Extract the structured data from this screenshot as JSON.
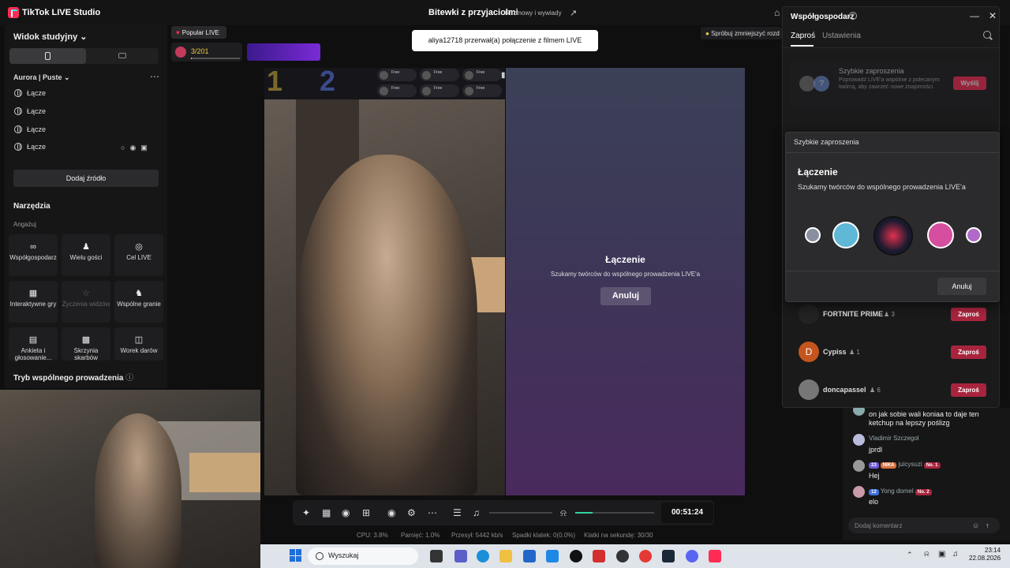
{
  "titlebar": {
    "app_title": "TikTok LIVE Studio",
    "stream_title": "Bitewki z przyjaciolmi",
    "stream_category": "Rozmowy i wywiady"
  },
  "sidebar": {
    "scene_view": "Widok studyjny",
    "scene_name": "Aurora | Puste",
    "sources": [
      "Łącze",
      "Łącze",
      "Łącze",
      "Łącze"
    ],
    "add_source": "Dodaj źródło",
    "tools_title": "Narzędzia",
    "engagement_label": "Angażuj",
    "tools": [
      {
        "label": "Współgospodarz",
        "icon": "link-icon"
      },
      {
        "label": "Wielu gości",
        "icon": "users-icon"
      },
      {
        "label": "Cel LIVE",
        "icon": "target-icon"
      },
      {
        "label": "Interaktywne gry",
        "icon": "gamepad-icon"
      },
      {
        "label": "Życzenia widzów",
        "icon": "star-icon"
      },
      {
        "label": "Wspólne granie",
        "icon": "joystick-icon"
      },
      {
        "label": "Ankieta i głosowanie...",
        "icon": "poll-icon"
      },
      {
        "label": "Skrzynia skarbów",
        "icon": "chest-icon"
      },
      {
        "label": "Worek darów",
        "icon": "gift-bag-icon"
      }
    ],
    "cohost_mode": "Tryb wspólnego prowadzenia"
  },
  "top": {
    "popular_live": "Popular LIVE",
    "goal_count": "3/201",
    "goal_progress": 0.015,
    "try_reduce": "Spróbuj zmniejszyć rozd"
  },
  "toast": "aliya12718 przerwał(a) połączenie z filmem LIVE",
  "scoreboard": {
    "left_number": "1",
    "right_number": "2",
    "slots": [
      "Free",
      "Free",
      "Free",
      "Free",
      "Free",
      "Free"
    ]
  },
  "connecting": {
    "title": "Łączenie",
    "subtitle": "Szukamy twórców do wspólnego prowadzenia LIVE'a",
    "cancel": "Anuluj"
  },
  "controls": {
    "timer": "00:51:24",
    "mic_level": 0.22
  },
  "stats": {
    "cpu": "CPU: 3.8%",
    "memory": "Pamięć: 1.0%",
    "sent": "Przesył: 5442 kb/s",
    "dropped": "Spadki klatek: 0(0.0%)",
    "fps": "Klatki na sekundę: 30/30"
  },
  "cohost_panel": {
    "title": "Współgospodarz",
    "tabs": [
      "Zaproś",
      "Ustawienia"
    ],
    "quick_invite_title": "Szybkie zaproszenia",
    "quick_invite_desc": "Poprowadź LIVE'a wspólnie z polecanym twórcą, aby zawrzeć nowe znajomości.",
    "send": "Wyślij",
    "popup": {
      "header": "Szybkie zaproszenia",
      "title": "Łączenie",
      "subtitle": "Szukamy twórców do wspólnego prowadzenia LIVE'a",
      "cancel": "Anuluj"
    },
    "creators": [
      {
        "name": "FORTNITE PRIME",
        "count": "3",
        "action": "Zaproś"
      },
      {
        "name": "Cypiss",
        "count": "1",
        "action": "Zaproś",
        "initial": "D"
      },
      {
        "name": "doncapassel",
        "count": "6",
        "action": "Zaproś"
      }
    ]
  },
  "chat": {
    "messages": [
      {
        "user": "",
        "text": "on jak sobie wali koniaa to daje ten ketchup na lepszy poślizg"
      },
      {
        "user": "Vladimir Szczegol",
        "text": "jprdl"
      },
      {
        "user": "juicysuzi",
        "badges": [
          "23",
          "NIKA",
          "No. 1"
        ],
        "text": "Hej"
      },
      {
        "user": "Yong domel",
        "badges": [
          "12",
          "No. 2"
        ],
        "text": "elo"
      }
    ],
    "placeholder": "Dodaj komentarz"
  },
  "taskbar": {
    "search": "Wyszukaj",
    "time": "23:14",
    "date": "22.08.2026"
  },
  "colors": {
    "accent": "#fe2c55",
    "panel": "#1a1a1b",
    "mic_level": "#2fd3a0"
  }
}
